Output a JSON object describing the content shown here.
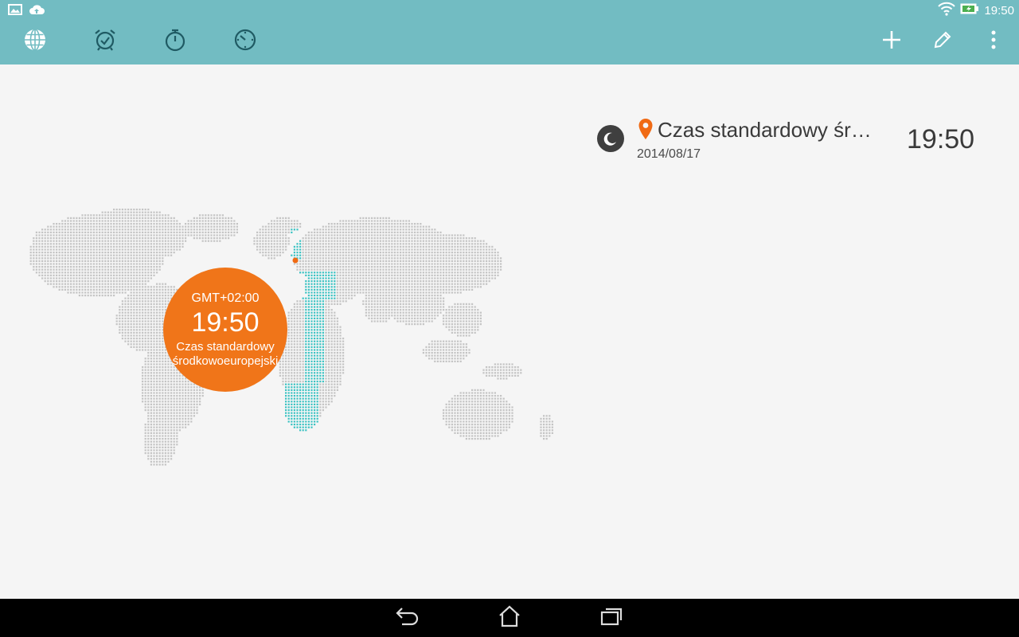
{
  "status_bar": {
    "time": "19:50",
    "icons": [
      "image-notification-icon",
      "cloud-upload-icon",
      "wifi-icon",
      "battery-charging-icon"
    ]
  },
  "action_bar": {
    "tabs": [
      {
        "name": "world-clock",
        "icon": "globe-icon",
        "selected": true
      },
      {
        "name": "alarm",
        "icon": "alarm-clock-icon",
        "selected": false
      },
      {
        "name": "stopwatch",
        "icon": "stopwatch-icon",
        "selected": false
      },
      {
        "name": "timer",
        "icon": "timer-icon",
        "selected": false
      }
    ],
    "actions": [
      "add-icon",
      "edit-pencil-icon",
      "overflow-menu-icon"
    ]
  },
  "city_list": [
    {
      "name": "Czas standardowy śr…",
      "date": "2014/08/17",
      "time": "19:50",
      "day_night": "night",
      "current_location": true
    }
  ],
  "map_bubble": {
    "gmt": "GMT+02:00",
    "time": "19:50",
    "name_line1": "Czas standardowy",
    "name_line2": "środkowoeuropejski"
  },
  "nav_bar": {
    "buttons": [
      "back-icon",
      "home-icon",
      "recent-apps-icon"
    ]
  },
  "colors": {
    "accent": "#72bcc2",
    "highlight_zone": "#3cc3c3",
    "bubble": "#f07519",
    "map_dots": "#c4c4c4"
  }
}
